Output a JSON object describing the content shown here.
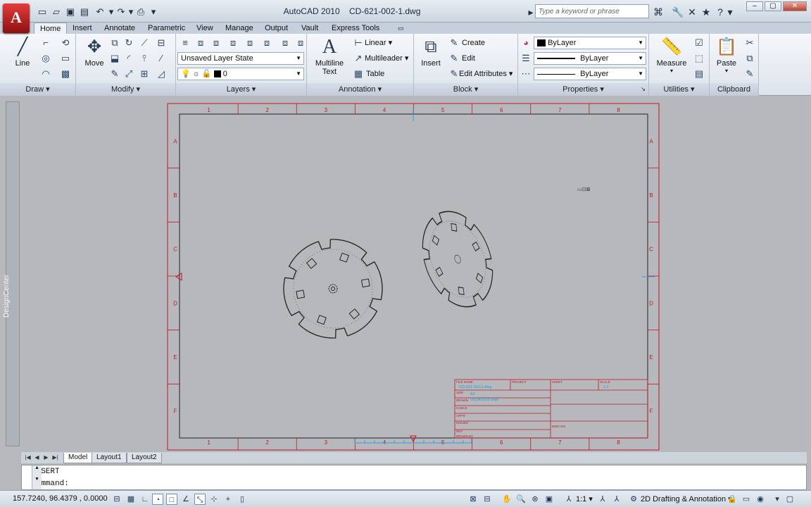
{
  "app": {
    "logo_letter": "A",
    "title": "AutoCAD 2010",
    "filename": "CD-621-002-1.dwg",
    "search_placeholder": "Type a keyword or phrase"
  },
  "ribbon_tabs": [
    "Home",
    "Insert",
    "Annotate",
    "Parametric",
    "View",
    "Manage",
    "Output",
    "Vault",
    "Express Tools"
  ],
  "active_tab": "Home",
  "panels": {
    "draw": {
      "title": "Draw",
      "line": "Line"
    },
    "modify": {
      "title": "Modify",
      "move": "Move"
    },
    "layers": {
      "title": "Layers",
      "layer_state": "Unsaved Layer State",
      "current_layer": "0"
    },
    "annotation": {
      "title": "Annotation",
      "multiline_text_1": "Multiline",
      "multiline_text_2": "Text",
      "linear": "Linear",
      "multileader": "Multileader",
      "table": "Table"
    },
    "block": {
      "title": "Block",
      "insert": "Insert",
      "create": "Create",
      "edit": "Edit",
      "edit_attributes": "Edit Attributes"
    },
    "properties": {
      "title": "Properties",
      "color": "ByLayer",
      "linetype": "ByLayer",
      "lineweight": "ByLayer"
    },
    "utilities": {
      "title": "Utilities",
      "measure": "Measure"
    },
    "clipboard": {
      "title": "Clipboard",
      "paste": "Paste"
    }
  },
  "palette": {
    "designcenter": "DesignCenter"
  },
  "drawing": {
    "columns": [
      "1",
      "2",
      "3",
      "4",
      "5",
      "6",
      "7",
      "8"
    ],
    "rows": [
      "A",
      "B",
      "C",
      "D",
      "E",
      "F"
    ],
    "title_block": {
      "file_name_label": "FILE NAME",
      "file_name_value": "CD-621-002-1.dwg",
      "project_label": "PROJECT",
      "sheet_label": "SHEET",
      "scale_label": "SCALE",
      "scale_value": "1:1",
      "size_label": "SIZE",
      "size_value": "A3",
      "drawn_label": "DRAWN",
      "drawn_value": "03/24/2009 shiin",
      "check_label": "CHECK",
      "appd_label": "APP'D",
      "issued_label": "ISSUED",
      "rev_label": "REV",
      "dwg_no_label": "DWG NO",
      "drawn_by_label": "DRAWN BY"
    }
  },
  "layout_tabs": [
    "Model",
    "Layout1",
    "Layout2"
  ],
  "active_layout": "Model",
  "command": {
    "history": "INSERT",
    "prompt": "Command:"
  },
  "status": {
    "coordinates": "157.7240, 96.4379 , 0.0000",
    "annotation_scale": "1:1",
    "workspace": "2D Drafting & Annotation"
  },
  "colors": {
    "frame_red": "#b01020",
    "title_blue": "#1aa0e0",
    "accent": "#c01818"
  }
}
